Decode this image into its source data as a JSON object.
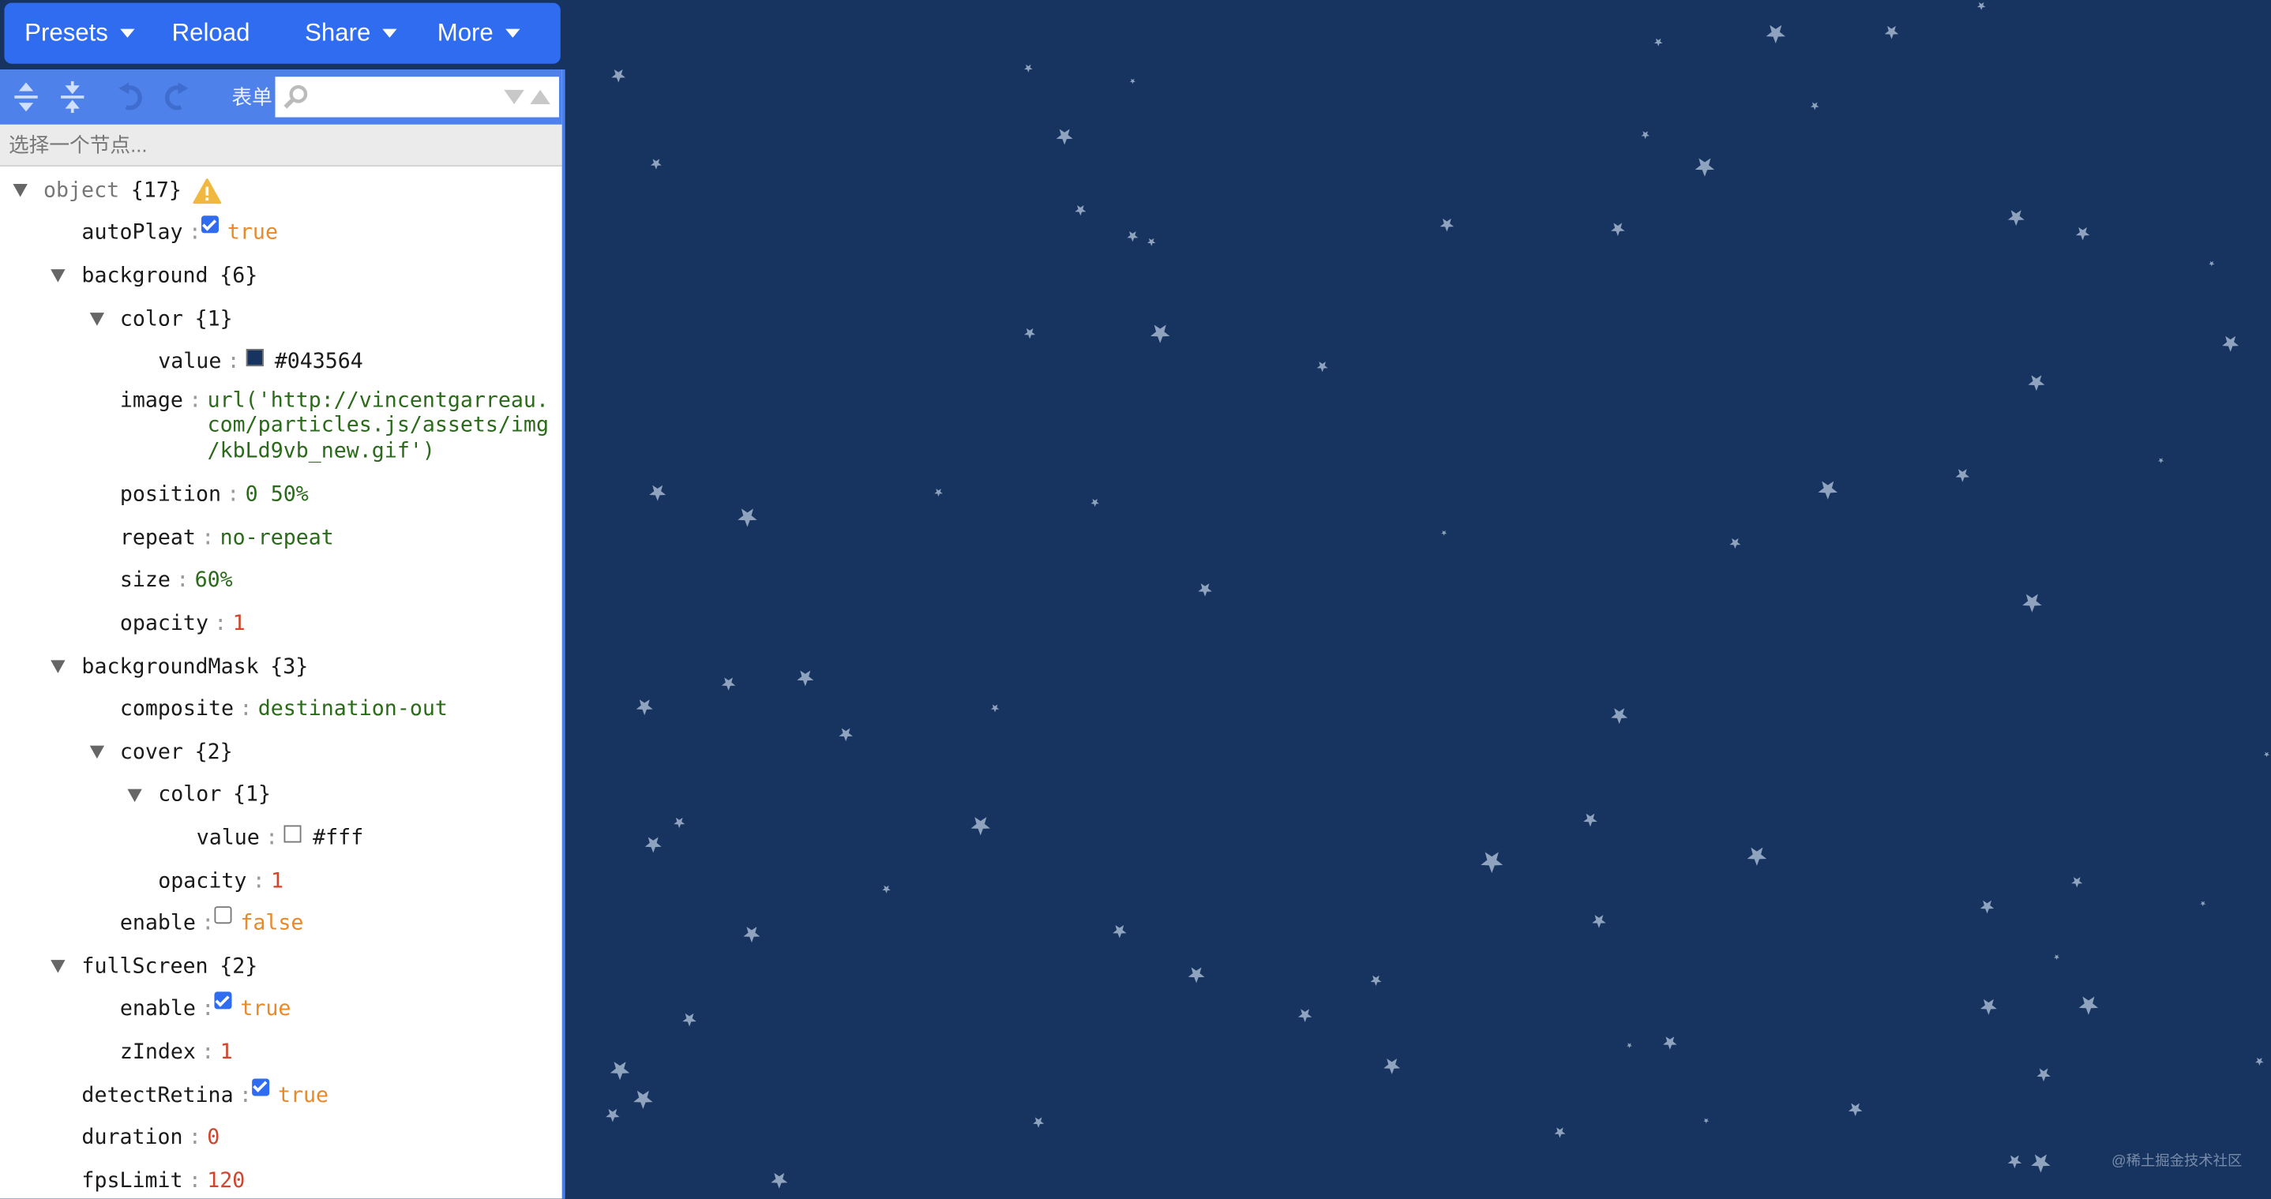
{
  "menubar": {
    "items": [
      {
        "label": "Presets",
        "has_dropdown": true
      },
      {
        "label": "Reload",
        "has_dropdown": false
      },
      {
        "label": "Share",
        "has_dropdown": true
      },
      {
        "label": "More",
        "has_dropdown": true
      }
    ]
  },
  "editor_toolbar": {
    "icons": [
      "expand-all-icon",
      "collapse-all-icon",
      "undo-icon",
      "redo-icon"
    ],
    "mode_label": "表单",
    "search": {
      "value": "",
      "placeholder": ""
    }
  },
  "navigation_bar": {
    "text": "选择一个节点..."
  },
  "tree": {
    "root": {
      "key": "object",
      "count": "{17}",
      "warning": true
    },
    "rows": [
      {
        "depth": 1,
        "key": "autoPlay",
        "type": "bool",
        "value": "true",
        "checked": true
      },
      {
        "depth": 1,
        "key": "background",
        "type": "object",
        "value": "{6}",
        "expanded": true
      },
      {
        "depth": 2,
        "key": "color",
        "type": "object",
        "value": "{1}",
        "expanded": true
      },
      {
        "depth": 3,
        "key": "value",
        "type": "color",
        "value": "#043564",
        "swatch": "#16345f"
      },
      {
        "depth": 2,
        "key": "image",
        "type": "string",
        "value": "url('http://vincentgarreau.com/particles.js/assets/img/kbLd9vb_new.gif')",
        "lines": [
          "url('http://vincentgarreau.",
          "com/particles.js/assets/img",
          "/kbLd9vb_new.gif')"
        ]
      },
      {
        "depth": 2,
        "key": "position",
        "type": "string",
        "value": "0 50%"
      },
      {
        "depth": 2,
        "key": "repeat",
        "type": "string",
        "value": "no-repeat"
      },
      {
        "depth": 2,
        "key": "size",
        "type": "string",
        "value": "60%"
      },
      {
        "depth": 2,
        "key": "opacity",
        "type": "number",
        "value": "1"
      },
      {
        "depth": 1,
        "key": "backgroundMask",
        "type": "object",
        "value": "{3}",
        "expanded": true
      },
      {
        "depth": 2,
        "key": "composite",
        "type": "string",
        "value": "destination-out"
      },
      {
        "depth": 2,
        "key": "cover",
        "type": "object",
        "value": "{2}",
        "expanded": true
      },
      {
        "depth": 3,
        "key": "color",
        "type": "object",
        "value": "{1}",
        "expanded": true
      },
      {
        "depth": 4,
        "key": "value",
        "type": "color",
        "value": "#fff",
        "swatch": "#ffffff"
      },
      {
        "depth": 3,
        "key": "opacity",
        "type": "number",
        "value": "1"
      },
      {
        "depth": 2,
        "key": "enable",
        "type": "bool",
        "value": "false",
        "checked": false
      },
      {
        "depth": 1,
        "key": "fullScreen",
        "type": "object",
        "value": "{2}",
        "expanded": true
      },
      {
        "depth": 2,
        "key": "enable",
        "type": "bool",
        "value": "true",
        "checked": true
      },
      {
        "depth": 2,
        "key": "zIndex",
        "type": "number",
        "value": "1"
      },
      {
        "depth": 1,
        "key": "detectRetina",
        "type": "bool",
        "value": "true",
        "checked": true
      },
      {
        "depth": 1,
        "key": "duration",
        "type": "number",
        "value": "0"
      },
      {
        "depth": 1,
        "key": "fpsLimit",
        "type": "number",
        "value": "120"
      }
    ]
  },
  "canvas": {
    "background_color": "#16345f",
    "particle_color": "#8fa3bf",
    "particle_shape": "star",
    "particle_count_visible": 80
  },
  "watermark": "@稀土掘金技术社区"
}
